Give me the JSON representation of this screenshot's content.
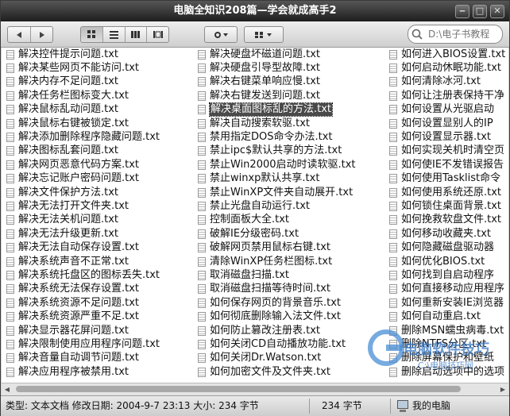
{
  "window": {
    "title": "电脑全知识208篇—学会就成高手2"
  },
  "window_buttons": [
    "‒",
    "□",
    "✕"
  ],
  "toolbar": {
    "back_icon": "back-arrow-icon",
    "forward_icon": "forward-arrow-icon",
    "views": [
      "icon-view-icon",
      "list-view-icon",
      "details-view-icon",
      "columns-view-icon"
    ],
    "action_icon": "gear-icon",
    "arrange_icon": "arrange-icon",
    "search_placeholder": "D:\\电子书教程"
  },
  "files": {
    "col1": [
      "解决控件提示问题.txt",
      "解决某些网页不能访问.txt",
      "解决内存不足问题.txt",
      "解决任务栏图标变大.txt",
      "解决鼠标乱动问题.txt",
      "解决鼠标右键被锁定.txt",
      "解决添加删除程序隐藏问题.txt",
      "解决图标乱套问题.txt",
      "解决网页恶意代码方案.txt",
      "解决忘记账户密码问题.txt",
      "解决文件保护方法.txt",
      "解决无法打开文件夹.txt",
      "解决无法关机问题.txt",
      "解决无法升级更新.txt",
      "解决无法自动保存设置.txt",
      "解决系统声音不正常.txt",
      "解决系统托盘区的图标丢失.txt",
      "解决系统无法保存设置.txt",
      "解决系统资源不足问题.txt",
      "解决系统资源严重不足.txt",
      "解决显示器花屏问题.txt",
      "解决限制使用应用程序问题.txt",
      "解决音量自动调节问题.txt",
      "解决应用程序被禁用.txt"
    ],
    "col2": [
      "解决硬盘坏磁道问题.txt",
      "解决硬盘引导型故障.txt",
      "解决右键菜单响应慢.txt",
      "解决右键发送到问题.txt",
      "解决桌面图标乱的方法.txt",
      "解决自动搜索软驱.txt",
      "禁用指定DOS命令办法.txt",
      "禁止ipc$默认共享的方法.txt",
      "禁止Win2000启动时读软驱.txt",
      "禁止winxp默认共享.txt",
      "禁止WinXP文件夹自动展开.txt",
      "禁止光盘自动运行.txt",
      "控制面板大全.txt",
      "破解IE分级密码.txt",
      "破解网页禁用鼠标右键.txt",
      "清除WinXP任务栏图标.txt",
      "取消磁盘扫描.txt",
      "取消磁盘扫描等待时间.txt",
      "如何保存网页的背景音乐.txt",
      "如何彻底删除输入法文件.txt",
      "如何防止篡改注册表.txt",
      "如何关闭CD自动播放功能.txt",
      "如何关闭Dr.Watson.txt",
      "如何加密文件及文件夹.txt"
    ],
    "col3": [
      "如何进入BIOS设置.txt",
      "如何启动休眠功能.txt",
      "如何清除冰河.txt",
      "如何让注册表保持干净",
      "如何设置从光驱启动",
      "如何设置显别人的IP",
      "如何设置显示器.txt",
      "如何实现关机时清空页",
      "如何使IE不发错误报告",
      "如何使用Tasklist命令",
      "如何使用系统还原.txt",
      "如何锁住桌面背景.txt",
      "如何挽救软盘文件.txt",
      "如何移动收藏夹.txt",
      "如何隐藏磁盘驱动器",
      "如何优化BIOS.txt",
      "如何找到自启动程序",
      "如何直接移动应用程序",
      "如何重新安装IE浏览器",
      "如何自动重启.txt",
      "删除MSN蠕虫病毒.txt",
      "删除NTFS分区.txt",
      "删除屏幕保护和壁纸",
      "删除启动选项中的选项"
    ],
    "selected": "解决桌面图标乱的方法.txt"
  },
  "watermark": {
    "brand": "电脑软件技巧",
    "subtitle": "C:\\电脑技巧网"
  },
  "status": {
    "info": "类型: 文本文档 修改日期: 2004-9-7 23:13 大小: 234 字节",
    "size": "234 字节",
    "location": "我的电脑"
  }
}
